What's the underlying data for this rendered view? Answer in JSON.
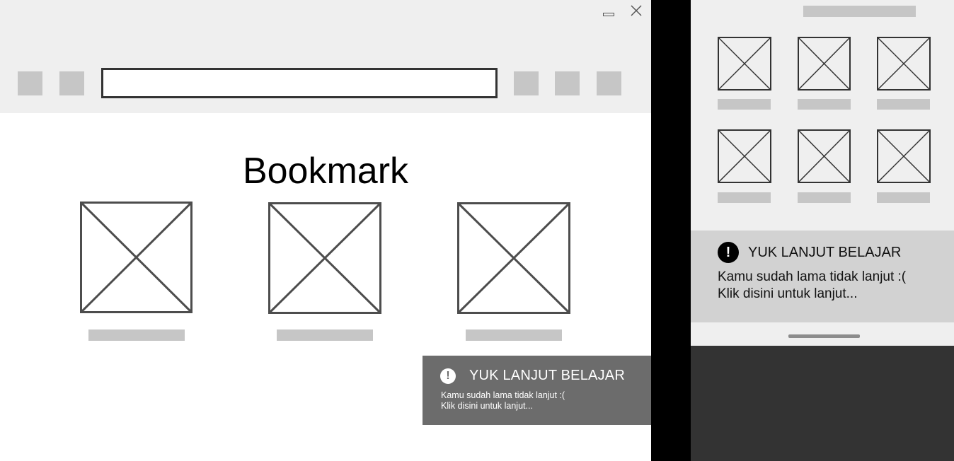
{
  "desktop": {
    "window_controls": {
      "minimize_icon": "minimize-icon",
      "close_icon": "close-icon"
    },
    "toolbar": {
      "left_buttons": [
        "placeholder-button",
        "placeholder-button"
      ],
      "address_value": "",
      "right_buttons": [
        "placeholder-button",
        "placeholder-button",
        "placeholder-button"
      ]
    },
    "page_title": "Bookmark",
    "bookmarks": [
      {
        "image": "image-placeholder-icon",
        "label": ""
      },
      {
        "image": "image-placeholder-icon",
        "label": ""
      },
      {
        "image": "image-placeholder-icon",
        "label": ""
      }
    ],
    "toast": {
      "icon": "!",
      "title": "YUK LANJUT BELAJAR",
      "line1": "Kamu sudah lama tidak lanjut :(",
      "line2": "Klik disini untuk lanjut..."
    }
  },
  "mobile": {
    "grid_items": [
      {
        "image": "image-placeholder-icon",
        "label": ""
      },
      {
        "image": "image-placeholder-icon",
        "label": ""
      },
      {
        "image": "image-placeholder-icon",
        "label": ""
      },
      {
        "image": "image-placeholder-icon",
        "label": ""
      },
      {
        "image": "image-placeholder-icon",
        "label": ""
      },
      {
        "image": "image-placeholder-icon",
        "label": ""
      }
    ],
    "toast": {
      "icon": "!",
      "title": "YUK LANJUT BELAJAR",
      "line1": "Kamu sudah lama tidak lanjut :(",
      "line2": "Klik disini untuk lanjut..."
    }
  },
  "colors": {
    "toolbar_bg": "#efefef",
    "placeholder_gray": "#c6c6c6",
    "toast_desktop_bg": "#6c6c6c",
    "toast_mobile_bg": "#d2d2d2",
    "dark_bg": "#333333"
  }
}
